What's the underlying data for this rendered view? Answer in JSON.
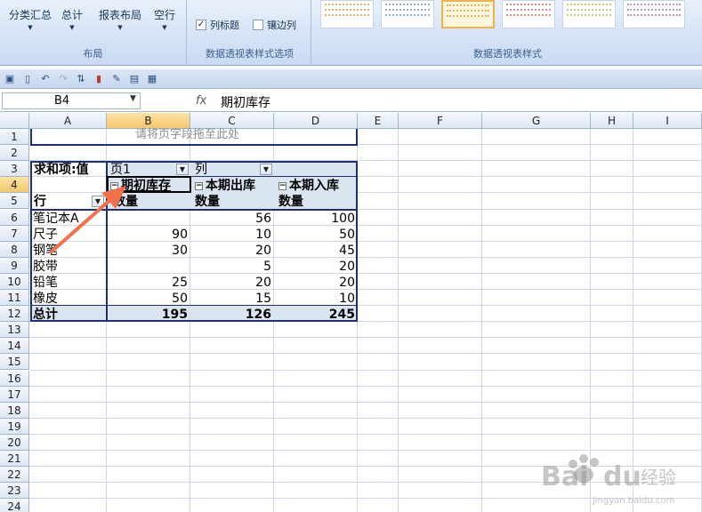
{
  "ribbon": {
    "buttons": [
      {
        "label": "分类汇总"
      },
      {
        "label": "总计"
      },
      {
        "label": "报表布局"
      },
      {
        "label": "空行"
      }
    ],
    "group_layout_label": "布局",
    "options": {
      "col_headers_label": "列标题",
      "col_headers_checked": true,
      "banded_cols_label": "镶边列",
      "banded_cols_checked": false
    },
    "group_options_label": "数据透视表样式选项",
    "group_styles_label": "数据透视表样式"
  },
  "formula_bar": {
    "name_box": "B4",
    "fx": "fx",
    "value": "期初库存"
  },
  "columns": [
    "A",
    "B",
    "C",
    "D",
    "E",
    "F",
    "G",
    "H",
    "I"
  ],
  "rows": [
    "1",
    "2",
    "3",
    "4",
    "5",
    "6",
    "7",
    "8",
    "9",
    "10",
    "11",
    "12",
    "13",
    "14",
    "15",
    "16",
    "17",
    "18",
    "19",
    "20",
    "21",
    "22",
    "23",
    "24"
  ],
  "pivot": {
    "page_drop_hint": "请将页字段拖至此处",
    "sum_label": "求和项:值",
    "page_field": "页1",
    "col_field": "列",
    "col_items": [
      "期初库存",
      "本期出库",
      "本期入库"
    ],
    "measure_label": "数量",
    "row_field": "行",
    "rows": [
      {
        "name": "笔记本A",
        "values": [
          "",
          "56",
          "100"
        ]
      },
      {
        "name": "尺子",
        "values": [
          "90",
          "10",
          "50"
        ]
      },
      {
        "name": "钢笔",
        "values": [
          "30",
          "20",
          "45"
        ]
      },
      {
        "name": "胶带",
        "values": [
          "",
          "5",
          "20"
        ]
      },
      {
        "name": "铅笔",
        "values": [
          "25",
          "20",
          "20"
        ]
      },
      {
        "name": "橡皮",
        "values": [
          "50",
          "15",
          "10"
        ]
      }
    ],
    "total_label": "总计",
    "totals": [
      "195",
      "126",
      "245"
    ]
  },
  "watermark": {
    "line1": "Baidu经验",
    "line2": "jingyan.baidu.com"
  },
  "colors": {
    "accent": "#f0b24a",
    "arrow": "#f2704a",
    "pivot_border": "#1f2f77"
  }
}
